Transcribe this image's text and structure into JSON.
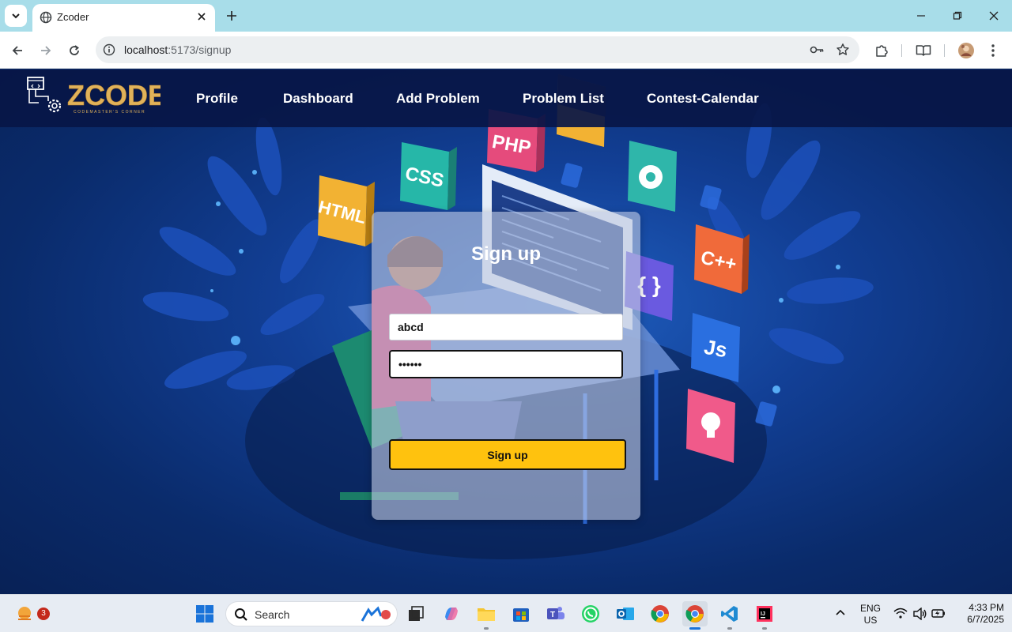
{
  "browser": {
    "tab_title": "Zcoder",
    "url_host": "localhost",
    "url_path": ":5173/signup"
  },
  "navbar": {
    "logo_text": "ZCODER",
    "logo_tagline": "CODEMASTER'S CORNER",
    "links": [
      {
        "label": "Profile"
      },
      {
        "label": "Dashboard"
      },
      {
        "label": "Add Problem"
      },
      {
        "label": "Problem List"
      },
      {
        "label": "Contest-Calendar"
      }
    ]
  },
  "background_tiles": [
    "PHP",
    "CSS",
    "HTML",
    "C++",
    "Js",
    "{ }"
  ],
  "signup": {
    "title": "Sign up",
    "username_value": "abcd",
    "password_value": "abcdef",
    "button_label": "Sign up"
  },
  "taskbar": {
    "weather_badge": "3",
    "search_label": "Search",
    "lang_line1": "ENG",
    "lang_line2": "US",
    "time": "4:33 PM",
    "date": "6/7/2025"
  },
  "colors": {
    "tabstrip": "#a8dde9",
    "navbar": "#081646",
    "button": "#ffc20e",
    "page_bg": "#123f95"
  }
}
